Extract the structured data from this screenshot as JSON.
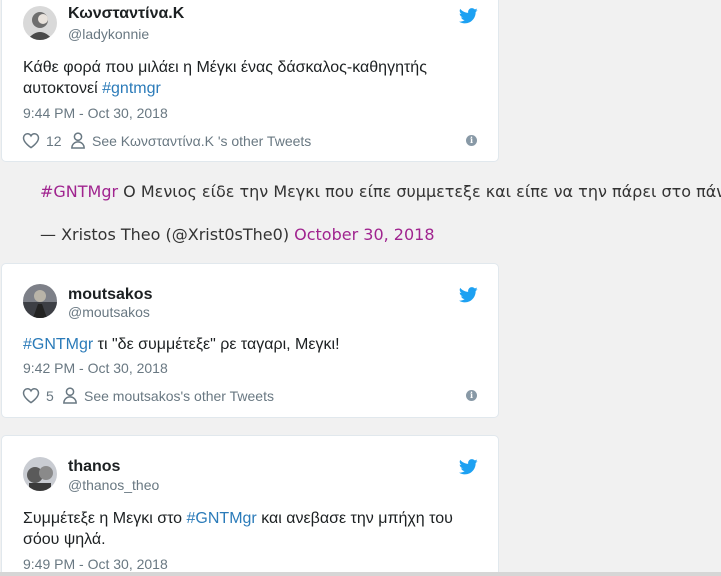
{
  "tweets": [
    {
      "name": "Κωνσταντίνα.Κ",
      "handle": "@ladykonnie",
      "text_line1": "Κάθε φορά που μιλάει η Μέγκι ένας δάσκαλος-καθηγητής",
      "text_line2_pre": "αυτοκτονεί ",
      "hashtag": "#gntmgr",
      "time": "9:44 PM - Oct 30, 2018",
      "likes": "12",
      "other_tweets": "See Κωνσταντίνα.Κ 's other Tweets"
    },
    {
      "name": "moutsakos",
      "handle": "@moutsakos",
      "hashtag": "#GNTMgr",
      "text_post": " τι \"δε συμμέτεξε\" ρε ταγαρι, Μεγκι!",
      "time": "9:42 PM - Oct 30, 2018",
      "likes": "5",
      "other_tweets": "See moutsakos's other Tweets"
    },
    {
      "name": "thanos",
      "handle": "@thanos_theo",
      "text_line1_pre": "Συμμέτεξε η Μεγκι στο ",
      "hashtag": "#GNTMgr",
      "text_line1_post": " και ανεβασε την μπήχη του",
      "text_line2": "σόου ψηλά.",
      "time": "9:49 PM - Oct 30, 2018"
    }
  ],
  "blockquote": {
    "hashtag": "#GNTMgr",
    "text": " Ο Μενιος είδε την Μεγκι που είπε συμμετεξε και είπε να την πάρει στο πάνελ",
    "attribution": "— Xristos Theo (@Xrist0sThe0) ",
    "date": "October 30, 2018"
  },
  "info_glyph": "i",
  "colors": {
    "twitter_blue": "#1da1f2",
    "hashtag_blue": "#2b7bb9",
    "quote_link": "#a0248f",
    "meta_gray": "#697882"
  },
  "icons": [
    "twitter-bird-icon",
    "heart-icon",
    "person-icon",
    "info-icon"
  ]
}
